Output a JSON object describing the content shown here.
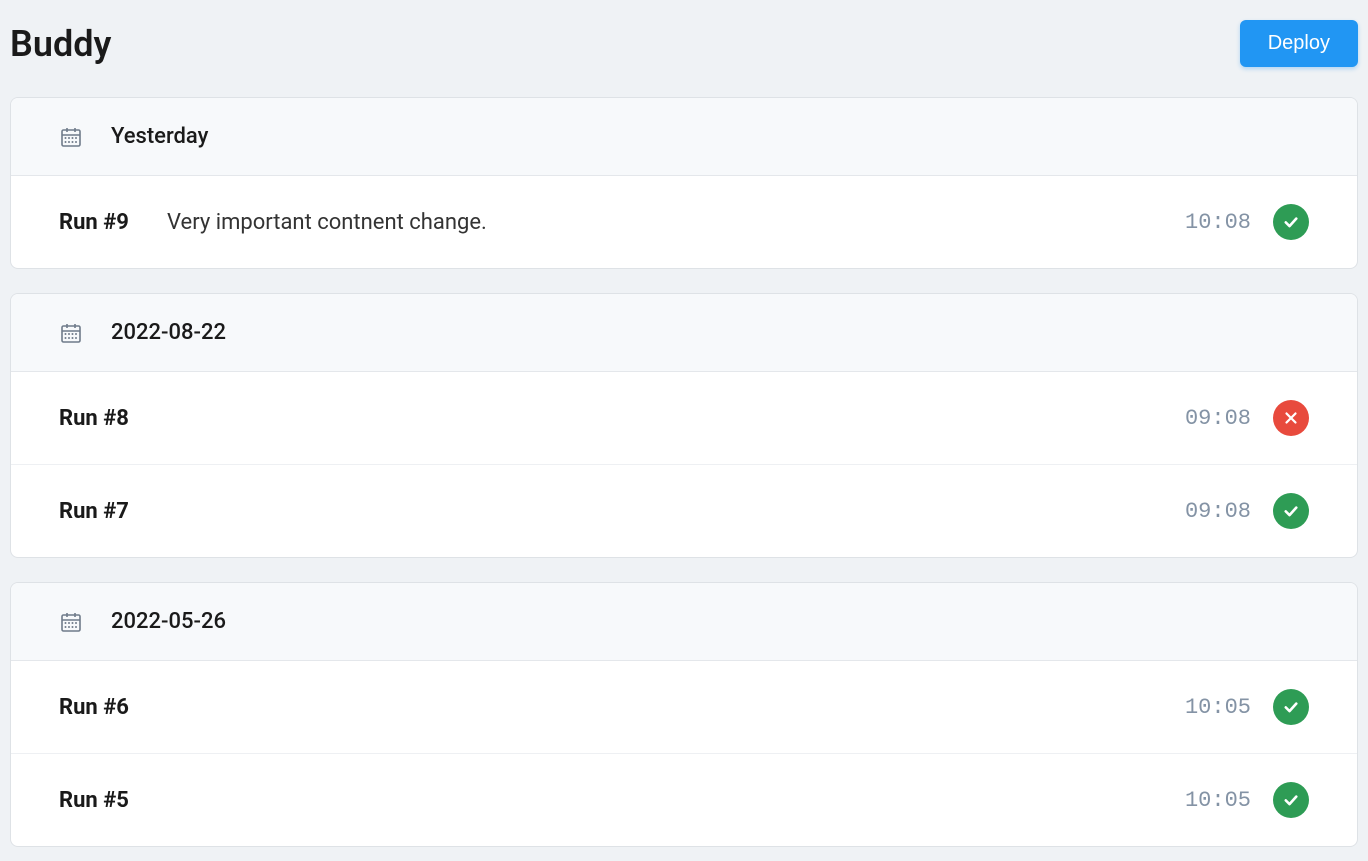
{
  "header": {
    "title": "Buddy",
    "deploy_label": "Deploy"
  },
  "groups": [
    {
      "date_label": "Yesterday",
      "runs": [
        {
          "number": "Run #9",
          "desc": "Very important contnent change.",
          "time": "10:08",
          "status": "success"
        }
      ]
    },
    {
      "date_label": "2022-08-22",
      "runs": [
        {
          "number": "Run #8",
          "desc": "",
          "time": "09:08",
          "status": "failed"
        },
        {
          "number": "Run #7",
          "desc": "",
          "time": "09:08",
          "status": "success"
        }
      ]
    },
    {
      "date_label": "2022-05-26",
      "runs": [
        {
          "number": "Run #6",
          "desc": "",
          "time": "10:05",
          "status": "success"
        },
        {
          "number": "Run #5",
          "desc": "",
          "time": "10:05",
          "status": "success"
        }
      ]
    }
  ]
}
